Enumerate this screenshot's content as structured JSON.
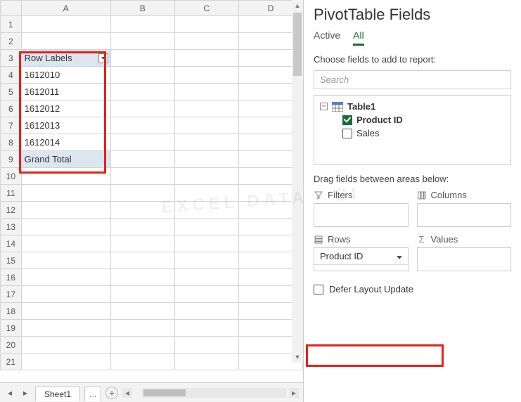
{
  "sheet": {
    "columns": [
      "A",
      "B",
      "C",
      "D"
    ],
    "row_count": 21,
    "selected_col": "A",
    "pivot": {
      "header": "Row Labels",
      "values": [
        "1612010",
        "1612011",
        "1612012",
        "1612013",
        "1612014"
      ],
      "total_label": "Grand Total"
    },
    "tab_name": "Sheet1",
    "tab_more": "...",
    "add_sheet": "+"
  },
  "pane": {
    "title": "PivotTable Fields",
    "tabs": {
      "active": "Active",
      "all": "All",
      "selected": "All"
    },
    "prompt": "Choose fields to add to report:",
    "search_placeholder": "Search",
    "tree": {
      "table": "Table1",
      "fields": [
        {
          "name": "Product ID",
          "checked": true
        },
        {
          "name": "Sales",
          "checked": false
        }
      ]
    },
    "drag_label": "Drag fields between areas below:",
    "areas": {
      "filters": "Filters",
      "columns": "Columns",
      "rows": "Rows",
      "values": "Values",
      "rows_chip": "Product ID"
    },
    "defer": "Defer Layout Update"
  },
  "watermark": "EXCEL DATA - BI"
}
